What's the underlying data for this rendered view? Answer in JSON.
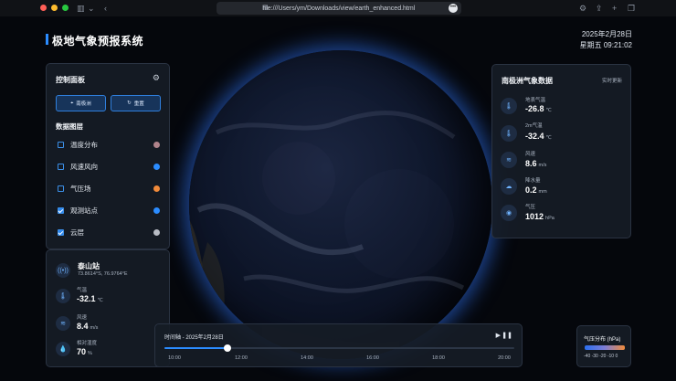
{
  "browser": {
    "url": "file:///Users/ym/Downloads/view/earth_enhanced.html",
    "traffic_light_colors": [
      "#ff5f57",
      "#febc2e",
      "#28c840"
    ]
  },
  "header": {
    "title": "极地气象预报系统",
    "date": "2025年2月28日",
    "time": "星期五 09:21:02"
  },
  "control_panel": {
    "title": "控制面板",
    "buttons": {
      "antarctica": "南极洲",
      "reset": "重置"
    },
    "layers_title": "数据图层",
    "layers": [
      {
        "label": "温度分布",
        "checked": false,
        "color": "#b0838b"
      },
      {
        "label": "风速风向",
        "checked": false,
        "color": "#2b8cff"
      },
      {
        "label": "气压场",
        "checked": false,
        "color": "#f08a3a"
      },
      {
        "label": "观测站点",
        "checked": true,
        "color": "#2b8cff"
      },
      {
        "label": "云层",
        "checked": true,
        "color": "#b8bcc4"
      }
    ]
  },
  "station": {
    "name": "泰山站",
    "coords": "73.8614°S, 76.9764°E",
    "metrics": [
      {
        "label": "气温",
        "value": "-32.1",
        "unit": "℃",
        "icon": "thermometer-icon"
      },
      {
        "label": "风速",
        "value": "8.4",
        "unit": "m/s",
        "icon": "wind-icon"
      },
      {
        "label": "相对湿度",
        "value": "70",
        "unit": "%",
        "icon": "droplet-icon"
      }
    ]
  },
  "weather_panel": {
    "title": "南极洲气象数据",
    "live": "实时更新",
    "items": [
      {
        "label": "地表气温",
        "value": "-26.8",
        "unit": "℃",
        "icon": "thermometer-icon"
      },
      {
        "label": "2m气温",
        "value": "-32.4",
        "unit": "℃",
        "icon": "thermometer-icon"
      },
      {
        "label": "风速",
        "value": "8.6",
        "unit": "m/s",
        "icon": "wind-icon"
      },
      {
        "label": "降水量",
        "value": "0.2",
        "unit": "mm",
        "icon": "cloud-rain-icon"
      },
      {
        "label": "气压",
        "value": "1012",
        "unit": "hPa",
        "icon": "gauge-icon"
      }
    ]
  },
  "timeline": {
    "label": "时间轴 - 2025年2月28日",
    "progress": 0.18,
    "ticks": [
      "10:00",
      "12:00",
      "14:00",
      "16:00",
      "18:00",
      "20:00"
    ]
  },
  "legend": {
    "title": "气压分布 (hPa)",
    "ticks": "-40 -30 -20 -10 0"
  },
  "colors": {
    "accent": "#2b8cff",
    "panel": "#161c26",
    "background": "#05070c"
  }
}
